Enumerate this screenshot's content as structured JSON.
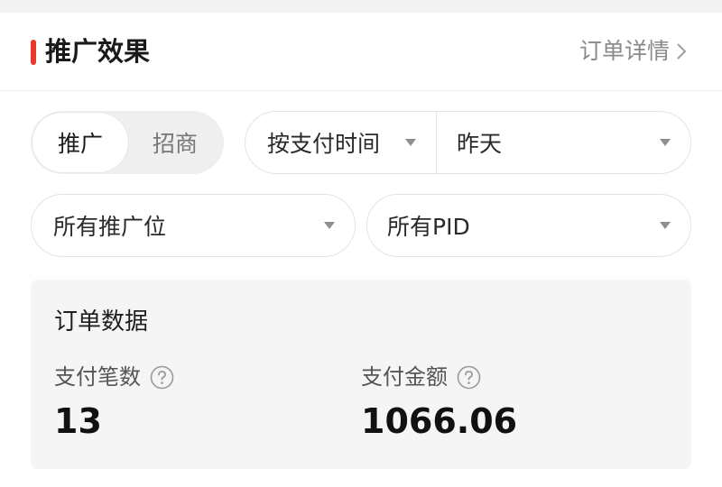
{
  "colors": {
    "accent": "#e8372c",
    "page_bg": "#ffffff",
    "card_bg": "#f5f5f5",
    "muted_text": "#8a8a8a"
  },
  "header": {
    "title": "推广效果",
    "link_label": "订单详情",
    "link_icon": "chevron-right-icon"
  },
  "filters": {
    "segment": {
      "options": [
        "推广",
        "招商"
      ],
      "selected": "推广"
    },
    "sort_by": {
      "label": "按支付时间",
      "icon": "caret-down-icon"
    },
    "date_range": {
      "label": "昨天",
      "icon": "caret-down-icon"
    },
    "position": {
      "label": "所有推广位",
      "icon": "caret-down-icon"
    },
    "pid": {
      "label": "所有PID",
      "icon": "caret-down-icon"
    }
  },
  "order_data": {
    "title": "订单数据",
    "metrics": [
      {
        "label": "支付笔数",
        "value": "13",
        "help_icon": "question-circle-icon"
      },
      {
        "label": "支付金额",
        "value": "1066.06",
        "help_icon": "question-circle-icon"
      }
    ]
  }
}
